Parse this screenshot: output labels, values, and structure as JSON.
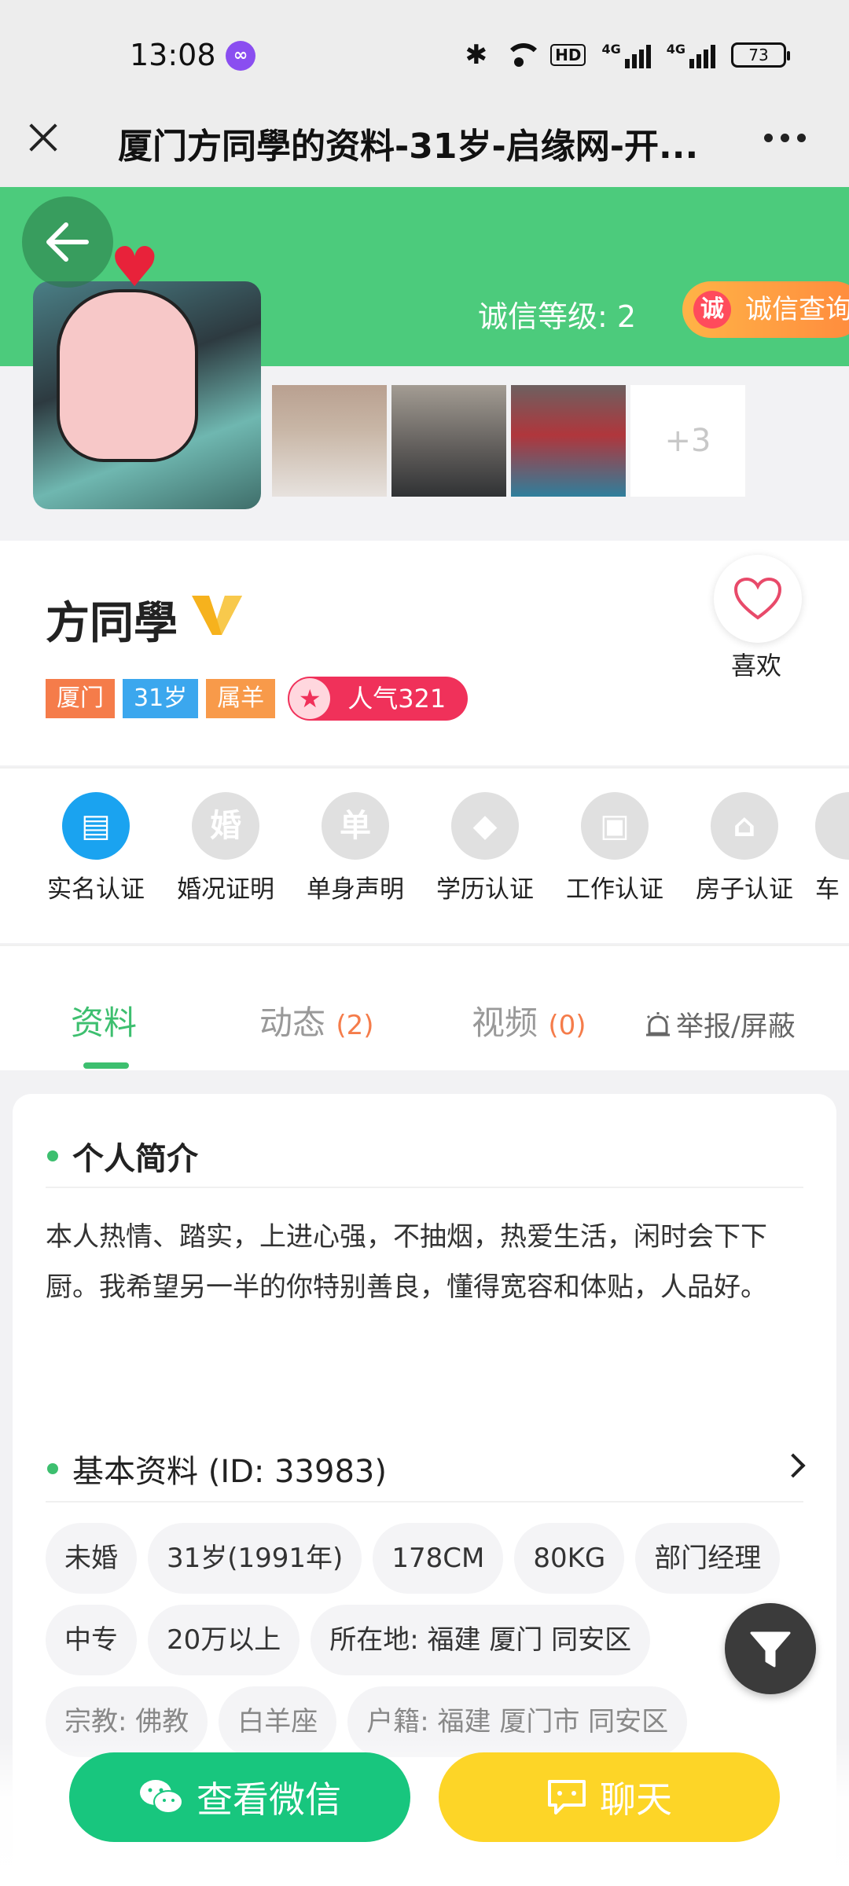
{
  "status_bar": {
    "time": "13:08",
    "hd": "HD",
    "net1": "4G",
    "net2": "4G",
    "battery": "73"
  },
  "title_bar": {
    "title": "厦门方同學的资料-31岁-启缘网-开..."
  },
  "header": {
    "credit_label": "诚信等级: 2",
    "credit_button_icon": "诚",
    "credit_button": "诚信查询",
    "more_photos": "+3"
  },
  "profile": {
    "name": "方同學",
    "tags": {
      "city": "厦门",
      "age": "31岁",
      "zodiac": "属羊"
    },
    "popularity": "人气321",
    "like_label": "喜欢"
  },
  "certs": [
    {
      "label": "实名认证",
      "icon": "id-card-icon",
      "glyph": "▤"
    },
    {
      "label": "婚况证明",
      "icon": "marriage-icon",
      "glyph": "婚"
    },
    {
      "label": "单身声明",
      "icon": "single-icon",
      "glyph": "单"
    },
    {
      "label": "学历认证",
      "icon": "graduation-cap-icon",
      "glyph": "◆"
    },
    {
      "label": "工作认证",
      "icon": "briefcase-icon",
      "glyph": "▣"
    },
    {
      "label": "房子认证",
      "icon": "house-icon",
      "glyph": "⌂"
    },
    {
      "label": "车",
      "icon": "car-icon",
      "glyph": ""
    }
  ],
  "tabs": {
    "profile": "资料",
    "moments": "动态",
    "moments_count": "(2)",
    "videos": "视频",
    "videos_count": "(0)",
    "report": "举报/屏蔽"
  },
  "intro": {
    "title": "个人简介",
    "text": "本人热情、踏实，上进心强，不抽烟，热爱生活，闲时会下下厨。我希望另一半的你特别善良，懂得宽容和体贴，人品好。"
  },
  "basic": {
    "title": "基本资料 (ID: 33983)",
    "chips": [
      "未婚",
      "31岁(1991年)",
      "178CM",
      "80KG",
      "部门经理",
      "中专",
      "20万以上",
      "所在地: 福建 厦门 同安区"
    ],
    "chips_faded": [
      "宗教: 佛教",
      "白羊座",
      "户籍: 福建 厦门市 同安区"
    ]
  },
  "actions": {
    "wechat": "查看微信",
    "chat": "聊天"
  },
  "colors": {
    "brand_green": "#4ccb7c",
    "accent_green": "#3dbf6f",
    "wechat_green": "#18c67e",
    "chat_yellow": "#fdd527",
    "popularity_red": "#f0315a"
  }
}
